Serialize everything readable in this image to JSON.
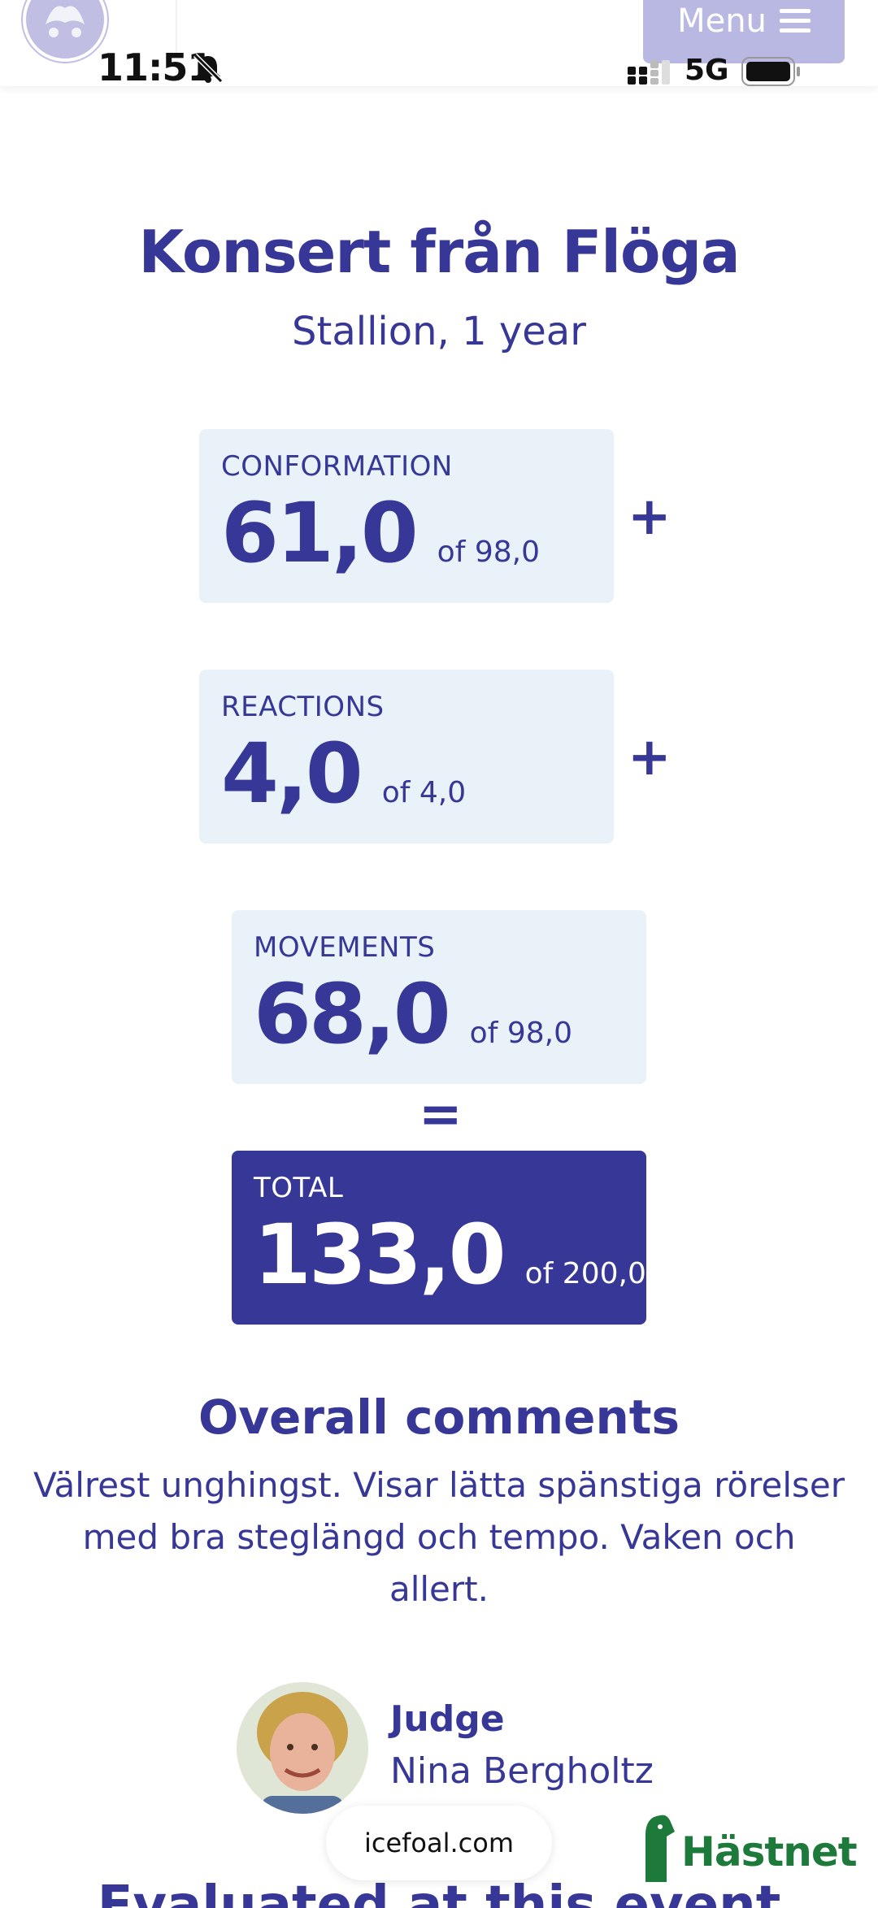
{
  "status_bar": {
    "time": "11:51",
    "network": "5G",
    "icons": [
      "bell-slash-icon",
      "signal-icon",
      "battery-icon"
    ]
  },
  "header": {
    "logo": "site-logo",
    "menu_label": "Menu",
    "menu_icon": "hamburger-icon"
  },
  "horse": {
    "name": "Konsert från Flöga",
    "subtitle": "Stallion, 1 year"
  },
  "scores": {
    "conformation": {
      "label": "CONFORMATION",
      "value": "61,0",
      "max": "of 98,0",
      "operator": "+"
    },
    "reactions": {
      "label": "REACTIONS",
      "value": "4,0",
      "max": "of 4,0",
      "operator": "+"
    },
    "movements": {
      "label": "MOVEMENTS",
      "value": "68,0",
      "max": "of 98,0",
      "operator": "="
    },
    "total": {
      "label": "TOTAL",
      "value": "133,0",
      "max": "of 200,0"
    }
  },
  "comments": {
    "title": "Overall comments",
    "text": "Välrest unghingst. Visar lätta spänstiga rörelser med bra steglängd och tempo. Vaken och allert."
  },
  "judge": {
    "label": "Judge",
    "name": "Nina Bergholtz"
  },
  "footer": {
    "url": "icefoal.com",
    "brand": "Hästnet",
    "next_heading": "Evaluated at this event"
  },
  "colors": {
    "primary": "#363796",
    "card_bg": "#e8f2f8",
    "menu_bg": "#b9b8e2",
    "brand_green": "#1d7a3a"
  }
}
